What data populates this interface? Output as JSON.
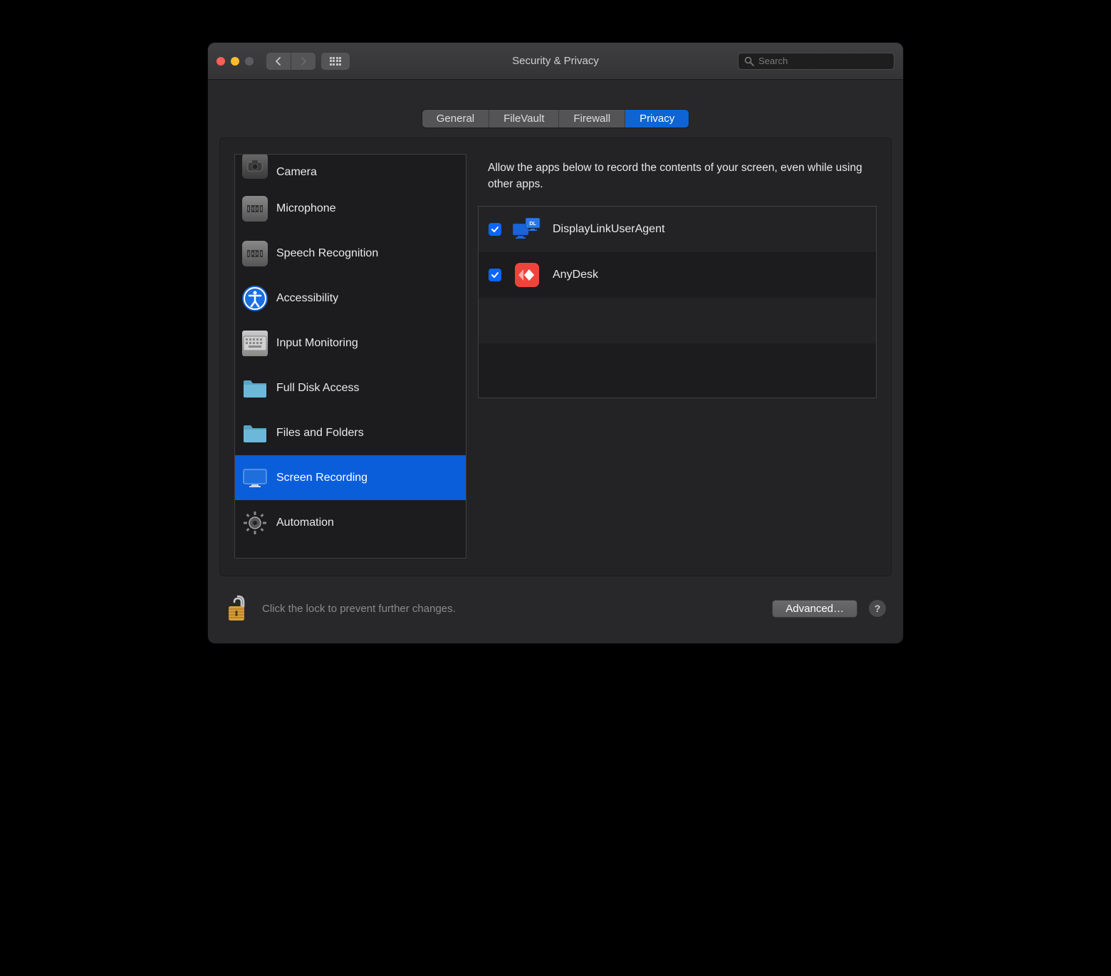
{
  "window": {
    "title": "Security & Privacy"
  },
  "toolbar": {
    "search_placeholder": "Search"
  },
  "tabs": {
    "general": "General",
    "filevault": "FileVault",
    "firewall": "Firewall",
    "privacy": "Privacy"
  },
  "sidebar": {
    "items": [
      {
        "label": "Camera",
        "icon": "camera-icon",
        "selected": false
      },
      {
        "label": "Microphone",
        "icon": "microphone-icon",
        "selected": false
      },
      {
        "label": "Speech Recognition",
        "icon": "speech-icon",
        "selected": false
      },
      {
        "label": "Accessibility",
        "icon": "accessibility-icon",
        "selected": false
      },
      {
        "label": "Input Monitoring",
        "icon": "keyboard-icon",
        "selected": false
      },
      {
        "label": "Full Disk Access",
        "icon": "folder-icon",
        "selected": false
      },
      {
        "label": "Files and Folders",
        "icon": "folder-icon",
        "selected": false
      },
      {
        "label": "Screen Recording",
        "icon": "display-icon",
        "selected": true
      },
      {
        "label": "Automation",
        "icon": "gear-icon",
        "selected": false
      }
    ]
  },
  "detail": {
    "description": "Allow the apps below to record the contents of your screen, even while using other apps.",
    "apps": [
      {
        "name": "DisplayLinkUserAgent",
        "checked": true,
        "icon": "displaylink-app-icon"
      },
      {
        "name": "AnyDesk",
        "checked": true,
        "icon": "anydesk-app-icon"
      }
    ]
  },
  "footer": {
    "lock_text": "Click the lock to prevent further changes.",
    "advanced_label": "Advanced…"
  }
}
